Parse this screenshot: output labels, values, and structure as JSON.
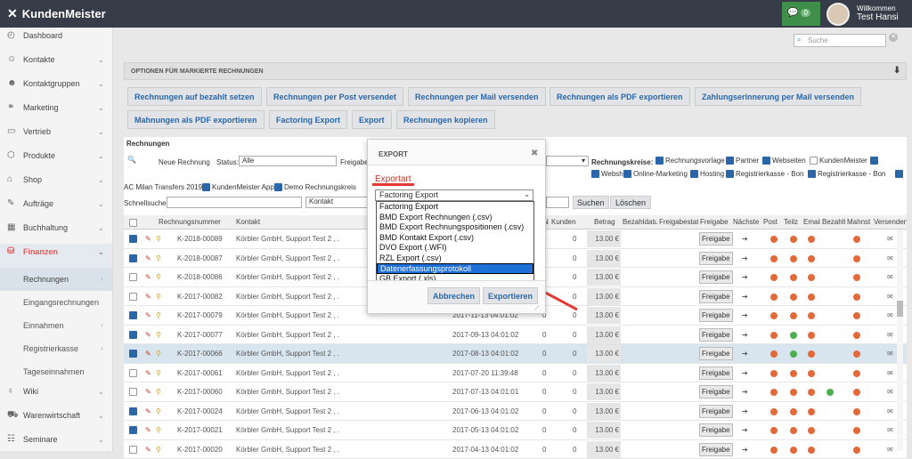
{
  "app": {
    "title": "KundenMeister"
  },
  "header": {
    "msg_count": "0",
    "welcome": "Willkommen",
    "user": "Test Hansi"
  },
  "sidebar": {
    "items": [
      {
        "label": "Dashboard",
        "icon": "dashboard-icon"
      },
      {
        "label": "Kontakte",
        "icon": "contacts-icon"
      },
      {
        "label": "Kontaktgruppen",
        "icon": "group-icon"
      },
      {
        "label": "Marketing",
        "icon": "marketing-icon"
      },
      {
        "label": "Vertrieb",
        "icon": "sales-icon"
      },
      {
        "label": "Produkte",
        "icon": "products-icon"
      },
      {
        "label": "Shop",
        "icon": "shop-icon"
      },
      {
        "label": "Aufträge",
        "icon": "orders-icon"
      },
      {
        "label": "Buchhaltung",
        "icon": "accounting-icon"
      },
      {
        "label": "Finanzen",
        "icon": "finance-icon"
      }
    ],
    "sub": [
      "Rechnungen",
      "Eingangsrechnungen",
      "Einnahmen",
      "Registrierkasse",
      "Tageseinnahmen"
    ],
    "more": [
      {
        "label": "Wiki",
        "icon": "wiki-icon"
      },
      {
        "label": "Warenwirtschaft",
        "icon": "warehouse-icon"
      },
      {
        "label": "Seminare",
        "icon": "seminar-icon"
      }
    ]
  },
  "search": {
    "placeholder": "Suche"
  },
  "options": {
    "title": "OPTIONEN FÜR MARKIERTE RECHNUNGEN",
    "buttons": [
      "Rechnungen auf bezahlt setzen",
      "Rechnungen per Post versendet",
      "Rechnungen per Mail versenden",
      "Rechnungen als PDF exportieren",
      "Zahlungserinnerung per Mail versenden",
      "Mahnungen als PDF exportieren",
      "Factoring Export",
      "Export",
      "Rechnungen kopieren"
    ]
  },
  "invoices": {
    "title": "Rechnungen",
    "new_label": "Neue Rechnung",
    "status_label": "Status:",
    "status_value": "Alle",
    "freigabe_label": "Freigabe",
    "kreise_label": "Rechnungskreise:",
    "kreise": [
      "Rechnungsvorlage",
      "Partner",
      "Webseiten",
      "KundenMeister",
      "Webshop",
      "Online-Marketing",
      "Hosting",
      "Registrierkasse - Bon",
      "Registrierkasse - Bon",
      "AC Milan Transfers 2019",
      "KundenMeister App",
      "Demo Rechnungskreis"
    ],
    "quick_label": "Schnellsuche",
    "contact_field": "Kontakt",
    "search_btn": "Suchen",
    "clear_btn": "Löschen",
    "columns": [
      "Rechnungsnummer",
      "Kontakt",
      "Kunden",
      "Betrag",
      "Bezahldatum",
      "Freigabestatus",
      "Freigabe",
      "Nächste",
      "Post",
      "Teilz",
      "Email",
      "Bezahlt",
      "Mahnst",
      "Versenden"
    ],
    "rows": [
      {
        "nr": "K-2018-00089",
        "kontakt": "Körbler GmbH, Support Test 2 , .",
        "datum": "",
        "zero": "0",
        "kunden": "0",
        "betrag": "13.00 €",
        "freigabe": "Freigabe"
      },
      {
        "nr": "K-2018-00087",
        "kontakt": "Körbler GmbH, Support Test 2 , .",
        "datum": "",
        "zero": "0",
        "kunden": "0",
        "betrag": "13.00 €",
        "freigabe": "Freigabe"
      },
      {
        "nr": "K-2018-00086",
        "kontakt": "Körbler GmbH, Support Test 2 , .",
        "datum": "",
        "zero": "0",
        "kunden": "0",
        "betrag": "13.00 €",
        "freigabe": "Freigabe"
      },
      {
        "nr": "K-2017-00082",
        "kontakt": "Körbler GmbH, Support Test 2 , .",
        "datum": "",
        "zero": "0",
        "kunden": "0",
        "betrag": "13.00 €",
        "freigabe": "Freigabe"
      },
      {
        "nr": "K-2017-00079",
        "kontakt": "Körbler GmbH, Support Test 2 , .",
        "datum": "2017-11-13 04:01:02",
        "zero": "0",
        "kunden": "0",
        "betrag": "13.00 €",
        "freigabe": "Freigabe"
      },
      {
        "nr": "K-2017-00077",
        "kontakt": "Körbler GmbH, Support Test 2 , .",
        "datum": "2017-09-13 04:01:02",
        "zero": "0",
        "kunden": "0",
        "betrag": "13.00 €",
        "freigabe": "Freigabe"
      },
      {
        "nr": "K-2017-00066",
        "kontakt": "Körbler GmbH, Support Test 2 , .",
        "datum": "2017-08-13 04:01:02",
        "zero": "0",
        "kunden": "0",
        "betrag": "13.00 €",
        "freigabe": "Freigabe"
      },
      {
        "nr": "K-2017-00061",
        "kontakt": "Körbler GmbH, Support Test 2 , .",
        "datum": "2017-07-20 11:39:48",
        "zero": "0",
        "kunden": "0",
        "betrag": "13.00 €",
        "freigabe": "Freigabe"
      },
      {
        "nr": "K-2017-00060",
        "kontakt": "Körbler GmbH, Support Test 2 , .",
        "datum": "2017-07-13 04:01:01",
        "zero": "0",
        "kunden": "0",
        "betrag": "13.00 €",
        "freigabe": "Freigabe"
      },
      {
        "nr": "K-2017-00024",
        "kontakt": "Körbler GmbH, Support Test 2 , .",
        "datum": "2017-06-13 04:01:02",
        "zero": "0",
        "kunden": "0",
        "betrag": "13.00 €",
        "freigabe": "Freigabe"
      },
      {
        "nr": "K-2017-00021",
        "kontakt": "Körbler GmbH, Support Test 2 , .",
        "datum": "2017-05-13 04:01:02",
        "zero": "0",
        "kunden": "0",
        "betrag": "13.00 €",
        "freigabe": "Freigabe"
      },
      {
        "nr": "K-2017-00020",
        "kontakt": "Körbler GmbH, Support Test 2 , .",
        "datum": "2017-04-13 04:01:02",
        "zero": "0",
        "kunden": "0",
        "betrag": "13.00 €",
        "freigabe": "Freigabe"
      }
    ]
  },
  "dialog": {
    "title": "EXPORT",
    "label": "Exportart",
    "selected": "Factoring Export",
    "options": [
      "Factoring Export",
      "BMD Export Rechnungen (.csv)",
      "BMD Export Rechnungspositionen (.csv)",
      "BMD Kontakt Export (.csv)",
      "DVO Export (.WFI)",
      "RZL Export (.csv)",
      "Datenerfassungsprotokoll",
      "GB Export (.xls)"
    ],
    "highlighted_option": "Datenerfassungsprotokoll",
    "cancel": "Abbrechen",
    "export": "Exportieren"
  },
  "colors": {
    "topbar": "#373d48",
    "accent": "#2b67a8",
    "active": "#e35a5a",
    "highlight": "#1e6fd8",
    "annotation": "#e53935"
  }
}
